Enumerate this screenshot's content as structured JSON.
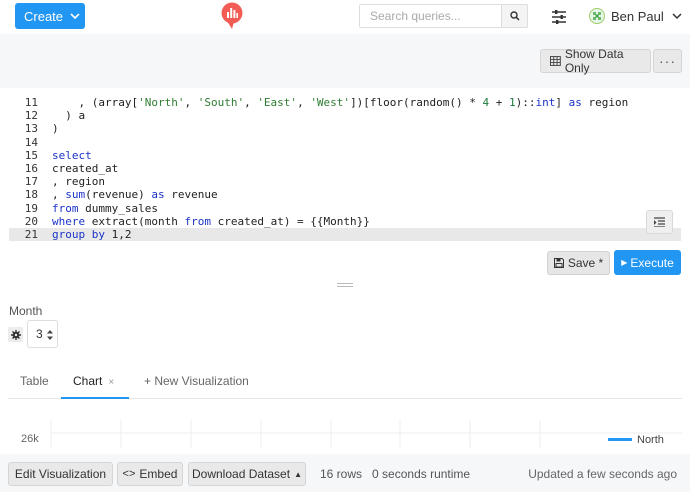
{
  "navbar": {
    "create_label": "Create",
    "search_placeholder": "Search queries...",
    "user_name": "Ben Paul"
  },
  "header": {
    "show_data_label": "Show Data Only",
    "more_label": "···"
  },
  "editor": {
    "lines": [
      {
        "num": "11",
        "tokens": [
          [
            "txt",
            "    , (array["
          ],
          [
            "str",
            "'North'"
          ],
          [
            "txt",
            ", "
          ],
          [
            "str",
            "'South'"
          ],
          [
            "txt",
            ", "
          ],
          [
            "str",
            "'East'"
          ],
          [
            "txt",
            ", "
          ],
          [
            "str",
            "'West'"
          ],
          [
            "txt",
            "])[floor(random() * "
          ],
          [
            "num",
            "4"
          ],
          [
            "txt",
            " + "
          ],
          [
            "num",
            "1"
          ],
          [
            "txt",
            ")::"
          ],
          [
            "kw",
            "int"
          ],
          [
            "txt",
            "] "
          ],
          [
            "kw",
            "as"
          ],
          [
            "txt",
            " region"
          ]
        ]
      },
      {
        "num": "12",
        "tokens": [
          [
            "txt",
            "  ) a"
          ]
        ]
      },
      {
        "num": "13",
        "tokens": [
          [
            "txt",
            ")"
          ]
        ]
      },
      {
        "num": "14",
        "tokens": []
      },
      {
        "num": "15",
        "tokens": [
          [
            "kw",
            "select"
          ]
        ]
      },
      {
        "num": "16",
        "tokens": [
          [
            "txt",
            "created_at"
          ]
        ]
      },
      {
        "num": "17",
        "tokens": [
          [
            "txt",
            ", region"
          ]
        ]
      },
      {
        "num": "18",
        "tokens": [
          [
            "txt",
            ", "
          ],
          [
            "kw",
            "sum"
          ],
          [
            "txt",
            "(revenue) "
          ],
          [
            "kw",
            "as"
          ],
          [
            "txt",
            " revenue"
          ]
        ]
      },
      {
        "num": "19",
        "tokens": [
          [
            "kw",
            "from"
          ],
          [
            "txt",
            " dummy_sales"
          ]
        ]
      },
      {
        "num": "20",
        "tokens": [
          [
            "kw",
            "where"
          ],
          [
            "txt",
            " extract(month "
          ],
          [
            "kw",
            "from"
          ],
          [
            "txt",
            " created_at) = {{Month}}"
          ]
        ]
      },
      {
        "num": "21",
        "tokens": [
          [
            "kw",
            "group"
          ],
          [
            "txt",
            " "
          ],
          [
            "kw",
            "by"
          ],
          [
            "txt",
            " 1,2"
          ]
        ],
        "active": true
      }
    ],
    "save_label": "Save *",
    "execute_label": "Execute"
  },
  "parameter": {
    "label": "Month",
    "value": "3"
  },
  "tabs": {
    "table": "Table",
    "chart": "Chart",
    "chart_close": "×",
    "new_viz": "+ New Visualization"
  },
  "chart_data": {
    "type": "line",
    "y_tick_visible": "26k",
    "legend_visible": [
      "North"
    ]
  },
  "bottom": {
    "edit_viz": "Edit Visualization",
    "embed": "Embed",
    "download": "Download Dataset",
    "rows": "16 rows",
    "runtime": "0 seconds runtime",
    "updated": "Updated a few seconds ago"
  },
  "colors": {
    "primary": "#2196f3",
    "logo": "#f25c54"
  }
}
